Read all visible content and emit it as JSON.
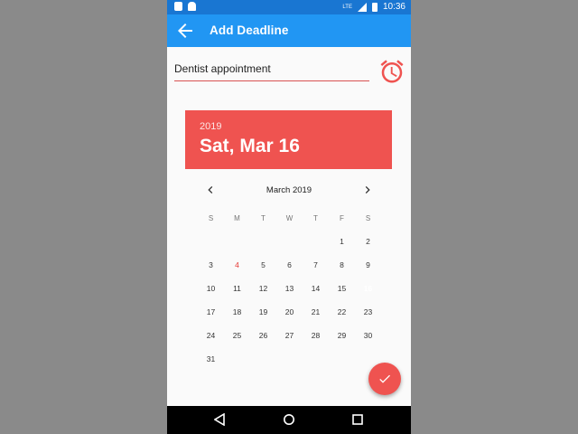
{
  "status_bar": {
    "time": "10:36",
    "network_label": "LTE"
  },
  "app_bar": {
    "title": "Add Deadline"
  },
  "deadline_input": {
    "value": "Dentist appointment",
    "placeholder": ""
  },
  "date_header": {
    "year": "2019",
    "date": "Sat, Mar 16"
  },
  "calendar": {
    "month_label": "March 2019",
    "weekdays": [
      "S",
      "M",
      "T",
      "W",
      "T",
      "F",
      "S"
    ],
    "weeks": [
      [
        "",
        "",
        "",
        "",
        "",
        "1",
        "2"
      ],
      [
        "3",
        "4",
        "5",
        "6",
        "7",
        "8",
        "9"
      ],
      [
        "10",
        "11",
        "12",
        "13",
        "14",
        "15",
        "16"
      ],
      [
        "17",
        "18",
        "19",
        "20",
        "21",
        "22",
        "23"
      ],
      [
        "24",
        "25",
        "26",
        "27",
        "28",
        "29",
        "30"
      ],
      [
        "31",
        "",
        "",
        "",
        "",
        "",
        ""
      ]
    ],
    "today": "4",
    "selected": "16"
  },
  "colors": {
    "status_bar": "#1976d2",
    "app_bar": "#2196f3",
    "accent": "#ef5350",
    "background": "#fafafa"
  },
  "icons": {
    "back": "arrow-left-icon",
    "alarm": "alarm-clock-icon",
    "prev": "chevron-left-icon",
    "next": "chevron-right-icon",
    "fab": "check-icon"
  }
}
